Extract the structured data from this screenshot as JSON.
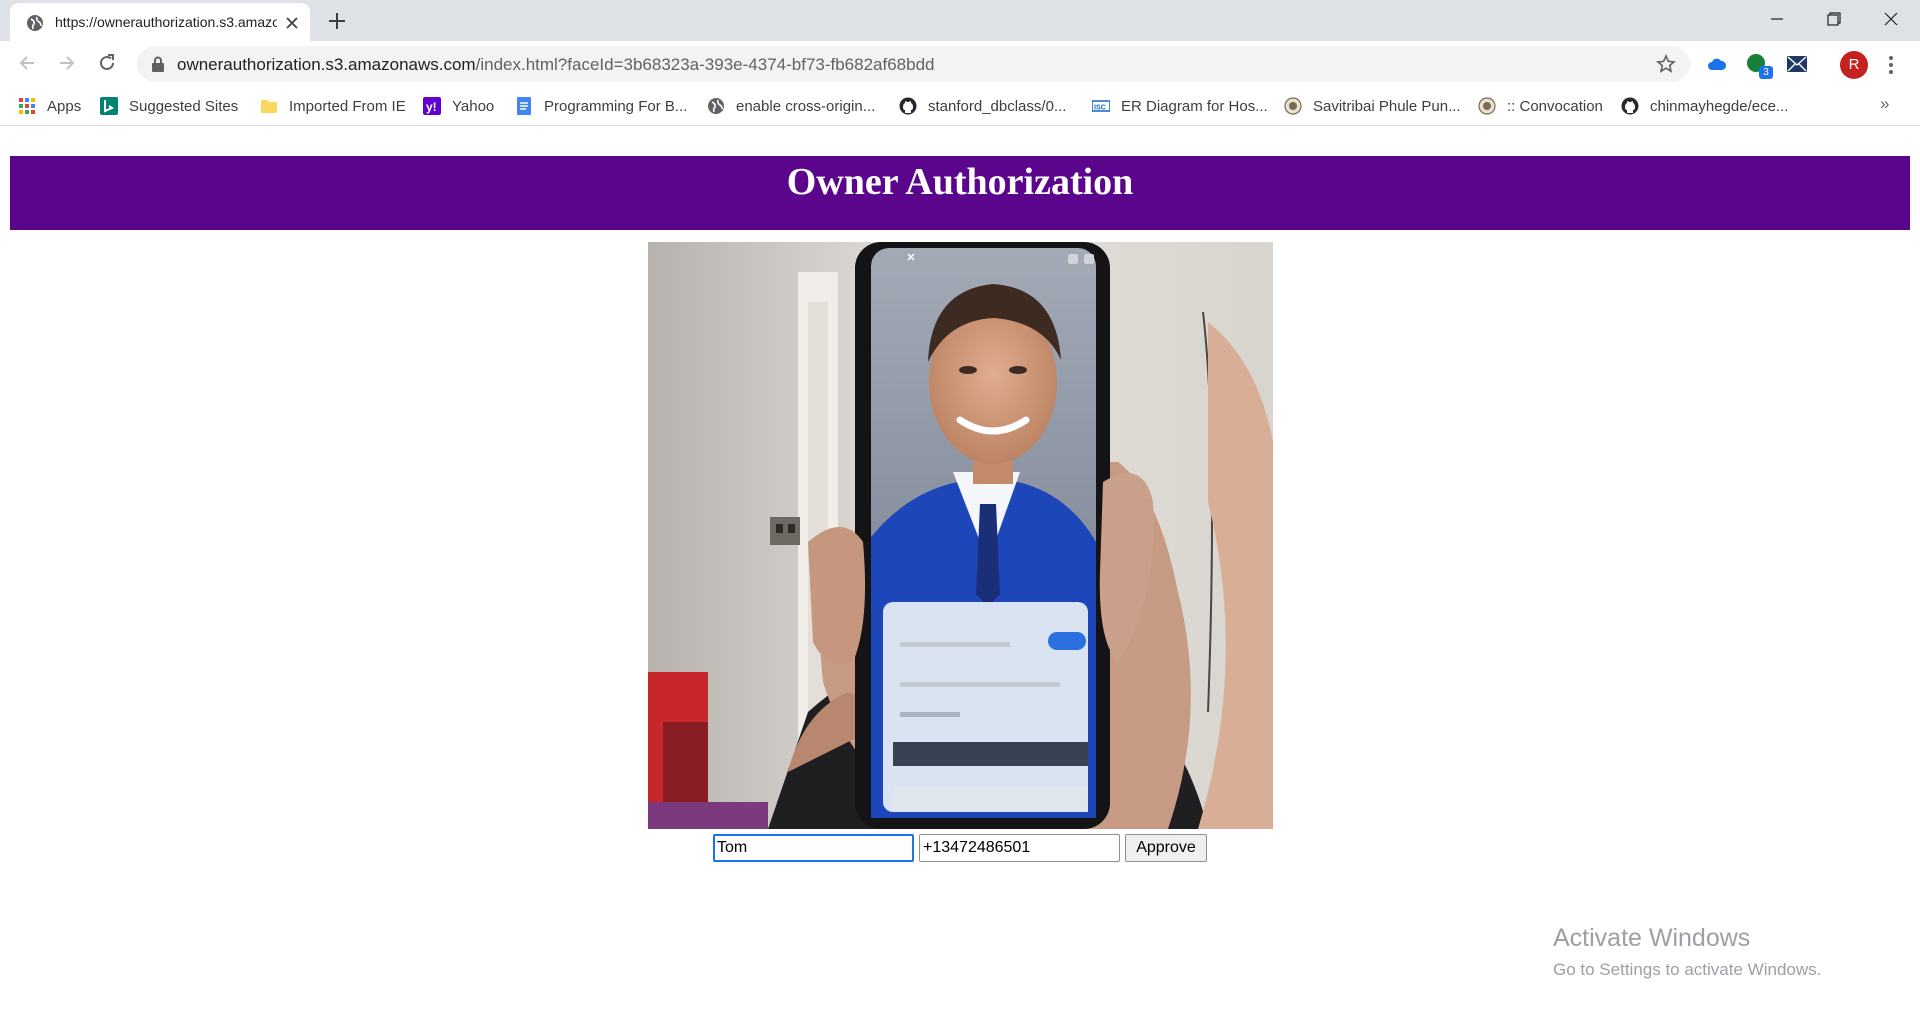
{
  "browser": {
    "tab": {
      "title": "https://ownerauthorization.s3.amazonaws.com/index.html?faceId=3b68323a-393e-4374-bf73-fb682af68bdd"
    },
    "address": {
      "host": "ownerauthorization.s3.amazonaws.com",
      "path": "/index.html?faceId=3b68323a-393e-4374-bf73-fb682af68bdd"
    },
    "extensions": [
      {
        "icon": "cloud-icon",
        "color": "#1a73e8"
      },
      {
        "icon": "chat-icon",
        "color": "#188038",
        "badge": "3"
      },
      {
        "icon": "mail-icon",
        "color": "#1f3864"
      }
    ],
    "profile_initial": "R",
    "profile_color": "#c5221f"
  },
  "bookmarks": [
    {
      "label": "Apps",
      "icon": "apps-grid-icon"
    },
    {
      "label": "Suggested Sites",
      "icon": "bing-icon"
    },
    {
      "label": "Imported From IE",
      "icon": "folder-icon"
    },
    {
      "label": "Yahoo",
      "icon": "yahoo-icon"
    },
    {
      "label": "Programming For B...",
      "icon": "document-icon"
    },
    {
      "label": "enable cross-origin...",
      "icon": "globe-icon"
    },
    {
      "label": "stanford_dbclass/0...",
      "icon": "github-icon"
    },
    {
      "label": "ER Diagram for Hos...",
      "icon": "site-icon"
    },
    {
      "label": "Savitribai Phule Pun...",
      "icon": "seal-icon"
    },
    {
      "label": ":: Convocation",
      "icon": "seal-icon"
    },
    {
      "label": "chinmayhegde/ece...",
      "icon": "github-icon"
    }
  ],
  "page": {
    "title": "Owner Authorization",
    "banner_color": "#5b058c",
    "form": {
      "name_value": "Tom",
      "phone_value": "+13472486501",
      "approve_label": "Approve"
    }
  },
  "watermark": {
    "line1": "Activate Windows",
    "line2": "Go to Settings to activate Windows."
  }
}
